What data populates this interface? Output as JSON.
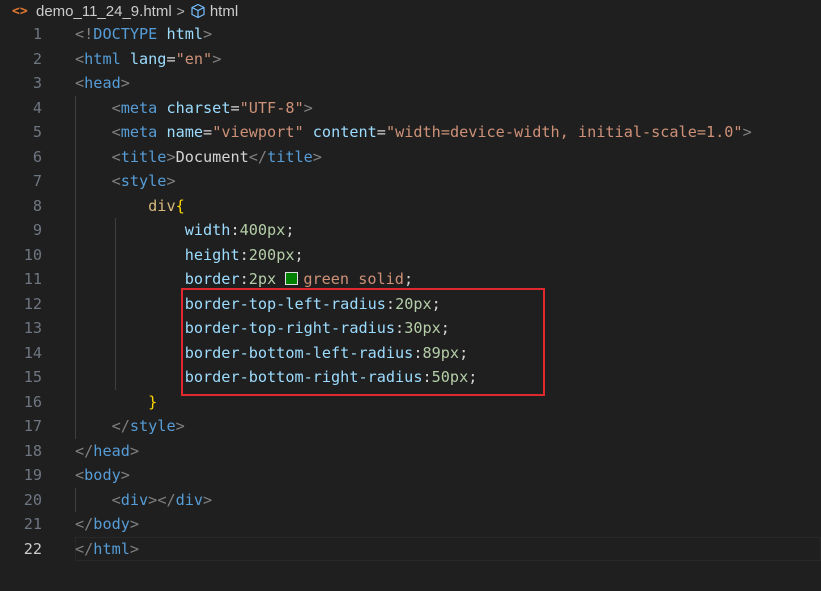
{
  "breadcrumb": {
    "file_icon": "<>",
    "file_name": "demo_11_24_9.html",
    "separator": ">",
    "node_icon": "cube-icon",
    "node_name": "html"
  },
  "editor": {
    "current_line": 22,
    "highlight_color": "#e0292e",
    "swatch_color": "#008000"
  },
  "lines": [
    {
      "n": "1",
      "tokens": [
        [
          "punc",
          "<!"
        ],
        [
          "tag",
          "DOCTYPE "
        ],
        [
          "attr",
          "html"
        ],
        [
          "punc",
          ">"
        ]
      ]
    },
    {
      "n": "2",
      "tokens": [
        [
          "punc",
          "<"
        ],
        [
          "tag",
          "html "
        ],
        [
          "attr",
          "lang"
        ],
        [
          "text",
          "="
        ],
        [
          "str",
          "\"en\""
        ],
        [
          "punc",
          ">"
        ]
      ]
    },
    {
      "n": "3",
      "tokens": [
        [
          "punc",
          "<"
        ],
        [
          "tag",
          "head"
        ],
        [
          "punc",
          ">"
        ]
      ]
    },
    {
      "n": "4",
      "tokens": [
        [
          "text",
          "    "
        ],
        [
          "punc",
          "<"
        ],
        [
          "tag",
          "meta "
        ],
        [
          "attr",
          "charset"
        ],
        [
          "text",
          "="
        ],
        [
          "str",
          "\"UTF-8\""
        ],
        [
          "punc",
          ">"
        ]
      ]
    },
    {
      "n": "5",
      "tokens": [
        [
          "text",
          "    "
        ],
        [
          "punc",
          "<"
        ],
        [
          "tag",
          "meta "
        ],
        [
          "attr",
          "name"
        ],
        [
          "text",
          "="
        ],
        [
          "str",
          "\"viewport\" "
        ],
        [
          "attr",
          "content"
        ],
        [
          "text",
          "="
        ],
        [
          "str",
          "\"width=device-width, initial-scale=1.0\""
        ],
        [
          "punc",
          ">"
        ]
      ]
    },
    {
      "n": "6",
      "tokens": [
        [
          "text",
          "    "
        ],
        [
          "punc",
          "<"
        ],
        [
          "tag",
          "title"
        ],
        [
          "punc",
          ">"
        ],
        [
          "text",
          "Document"
        ],
        [
          "punc",
          "</"
        ],
        [
          "tag",
          "title"
        ],
        [
          "punc",
          ">"
        ]
      ]
    },
    {
      "n": "7",
      "tokens": [
        [
          "text",
          "    "
        ],
        [
          "punc",
          "<"
        ],
        [
          "tag",
          "style"
        ],
        [
          "punc",
          ">"
        ]
      ]
    },
    {
      "n": "8",
      "tokens": [
        [
          "text",
          "        "
        ],
        [
          "sel",
          "div"
        ],
        [
          "brace",
          "{"
        ]
      ]
    },
    {
      "n": "9",
      "tokens": [
        [
          "text",
          "            "
        ],
        [
          "prop",
          "width"
        ],
        [
          "text",
          ":"
        ],
        [
          "num",
          "400px"
        ],
        [
          "text",
          ";"
        ]
      ]
    },
    {
      "n": "10",
      "tokens": [
        [
          "text",
          "            "
        ],
        [
          "prop",
          "height"
        ],
        [
          "text",
          ":"
        ],
        [
          "num",
          "200px"
        ],
        [
          "text",
          ";"
        ]
      ]
    },
    {
      "n": "11",
      "tokens": [
        [
          "text",
          "            "
        ],
        [
          "prop",
          "border"
        ],
        [
          "text",
          ":"
        ],
        [
          "num",
          "2px "
        ],
        [
          "swatch",
          ""
        ],
        [
          "val",
          "green solid"
        ],
        [
          "text",
          ";"
        ]
      ]
    },
    {
      "n": "12",
      "tokens": [
        [
          "text",
          "            "
        ],
        [
          "prop",
          "border-top-left-radius"
        ],
        [
          "text",
          ":"
        ],
        [
          "num",
          "20px"
        ],
        [
          "text",
          ";"
        ]
      ]
    },
    {
      "n": "13",
      "tokens": [
        [
          "text",
          "            "
        ],
        [
          "prop",
          "border-top-right-radius"
        ],
        [
          "text",
          ":"
        ],
        [
          "num",
          "30px"
        ],
        [
          "text",
          ";"
        ]
      ]
    },
    {
      "n": "14",
      "tokens": [
        [
          "text",
          "            "
        ],
        [
          "prop",
          "border-bottom-left-radius"
        ],
        [
          "text",
          ":"
        ],
        [
          "num",
          "89px"
        ],
        [
          "text",
          ";"
        ]
      ]
    },
    {
      "n": "15",
      "tokens": [
        [
          "text",
          "            "
        ],
        [
          "prop",
          "border-bottom-right-radius"
        ],
        [
          "text",
          ":"
        ],
        [
          "num",
          "50px"
        ],
        [
          "text",
          ";"
        ]
      ]
    },
    {
      "n": "16",
      "tokens": [
        [
          "text",
          "        "
        ],
        [
          "brace",
          "}"
        ]
      ]
    },
    {
      "n": "17",
      "tokens": [
        [
          "text",
          "    "
        ],
        [
          "punc",
          "</"
        ],
        [
          "tag",
          "style"
        ],
        [
          "punc",
          ">"
        ]
      ]
    },
    {
      "n": "18",
      "tokens": [
        [
          "punc",
          "</"
        ],
        [
          "tag",
          "head"
        ],
        [
          "punc",
          ">"
        ]
      ]
    },
    {
      "n": "19",
      "tokens": [
        [
          "punc",
          "<"
        ],
        [
          "tag",
          "body"
        ],
        [
          "punc",
          ">"
        ]
      ]
    },
    {
      "n": "20",
      "tokens": [
        [
          "text",
          "    "
        ],
        [
          "punc",
          "<"
        ],
        [
          "tag",
          "div"
        ],
        [
          "punc",
          "></"
        ],
        [
          "tag",
          "div"
        ],
        [
          "punc",
          ">"
        ]
      ]
    },
    {
      "n": "21",
      "tokens": [
        [
          "punc",
          "</"
        ],
        [
          "tag",
          "body"
        ],
        [
          "punc",
          ">"
        ]
      ]
    },
    {
      "n": "22",
      "tokens": [
        [
          "punc",
          "</"
        ],
        [
          "tag",
          "html"
        ],
        [
          "punc",
          ">"
        ]
      ]
    }
  ]
}
